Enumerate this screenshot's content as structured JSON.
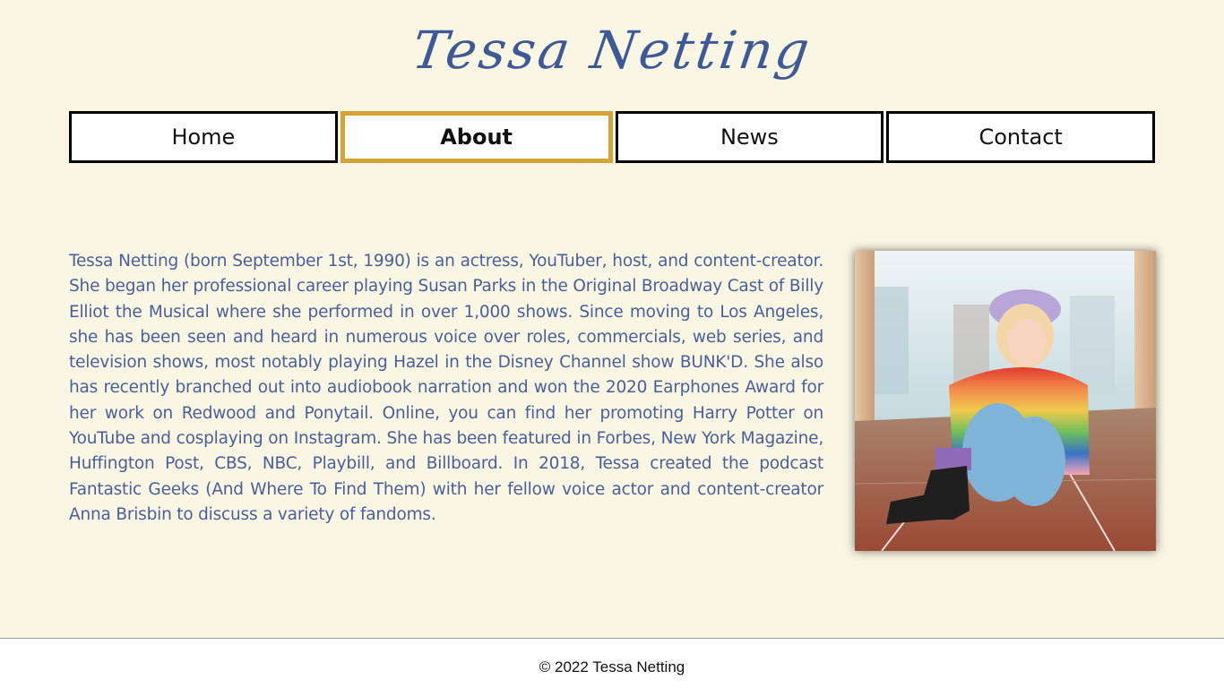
{
  "header": {
    "site_title": "Tessa  Netting"
  },
  "nav": {
    "items": [
      {
        "label": "Home",
        "active": false
      },
      {
        "label": "About",
        "active": true
      },
      {
        "label": "News",
        "active": false
      },
      {
        "label": "Contact",
        "active": false
      }
    ]
  },
  "main": {
    "bio": "Tessa Netting (born September 1st, 1990) is an actress, YouTuber, host, and content-creator. She began her professional career playing Susan Parks in the Original Broadway Cast of Billy Elliot the Musical where she performed in over 1,000 shows. Since moving to Los Angeles, she has been seen and heard in numerous voice over roles, commercials, web series, and television shows, most notably playing Hazel in the Disney Channel show BUNK'D. She also has recently branched out into audiobook narration and won the 2020 Earphones Award for her work on Redwood and Ponytail. Online, you can find her promoting Harry Potter on YouTube and cosplaying on Instagram. She has been featured in Forbes, New York Magazine, Huffington Post, CBS, NBC, Playbill, and Billboard. In 2018, Tessa created the podcast Fantastic Geeks (And Where To Find Them) with her fellow voice actor and content-creator Anna Brisbin to discuss a variety of fandoms."
  },
  "footer": {
    "copyright": "© 2022 Tessa Netting"
  },
  "colors": {
    "background": "#f9f6e3",
    "title": "#3d5a96",
    "bio_text": "#4a5f9a",
    "active_border": "#d4a437"
  }
}
